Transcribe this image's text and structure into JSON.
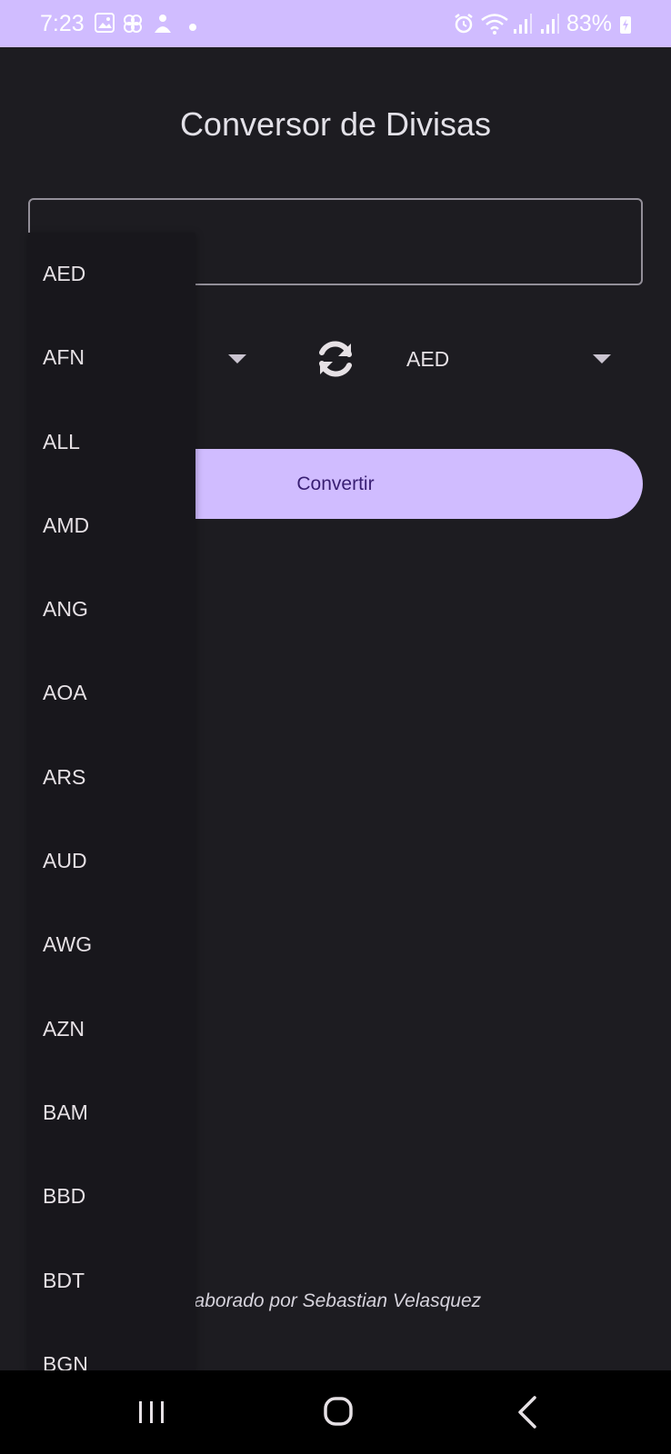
{
  "status_bar": {
    "time": "7:23",
    "battery": "83%",
    "icons": [
      "gallery-icon",
      "pinwheel-icon",
      "assistant-icon",
      "dot-icon",
      "alarm-icon",
      "wifi-icon",
      "signal-icon",
      "signal-icon",
      "battery-charging-icon"
    ]
  },
  "app": {
    "title": "Conversor de Divisas",
    "amount_value": "",
    "from_currency": "",
    "to_currency": "AED",
    "convert_label": "Convertir",
    "footer": "laborado por Sebastian Velasquez"
  },
  "dropdown": {
    "options": [
      "AED",
      "AFN",
      "ALL",
      "AMD",
      "ANG",
      "AOA",
      "ARS",
      "AUD",
      "AWG",
      "AZN",
      "BAM",
      "BBD",
      "BDT",
      "BGN"
    ]
  },
  "nav_bar": {
    "icons": [
      "recent-apps-icon",
      "home-icon",
      "back-icon"
    ]
  },
  "colors": {
    "accent": "#d0bcff",
    "background": "#1d1c21",
    "menu_background": "#18171c",
    "button_text": "#381e72"
  }
}
